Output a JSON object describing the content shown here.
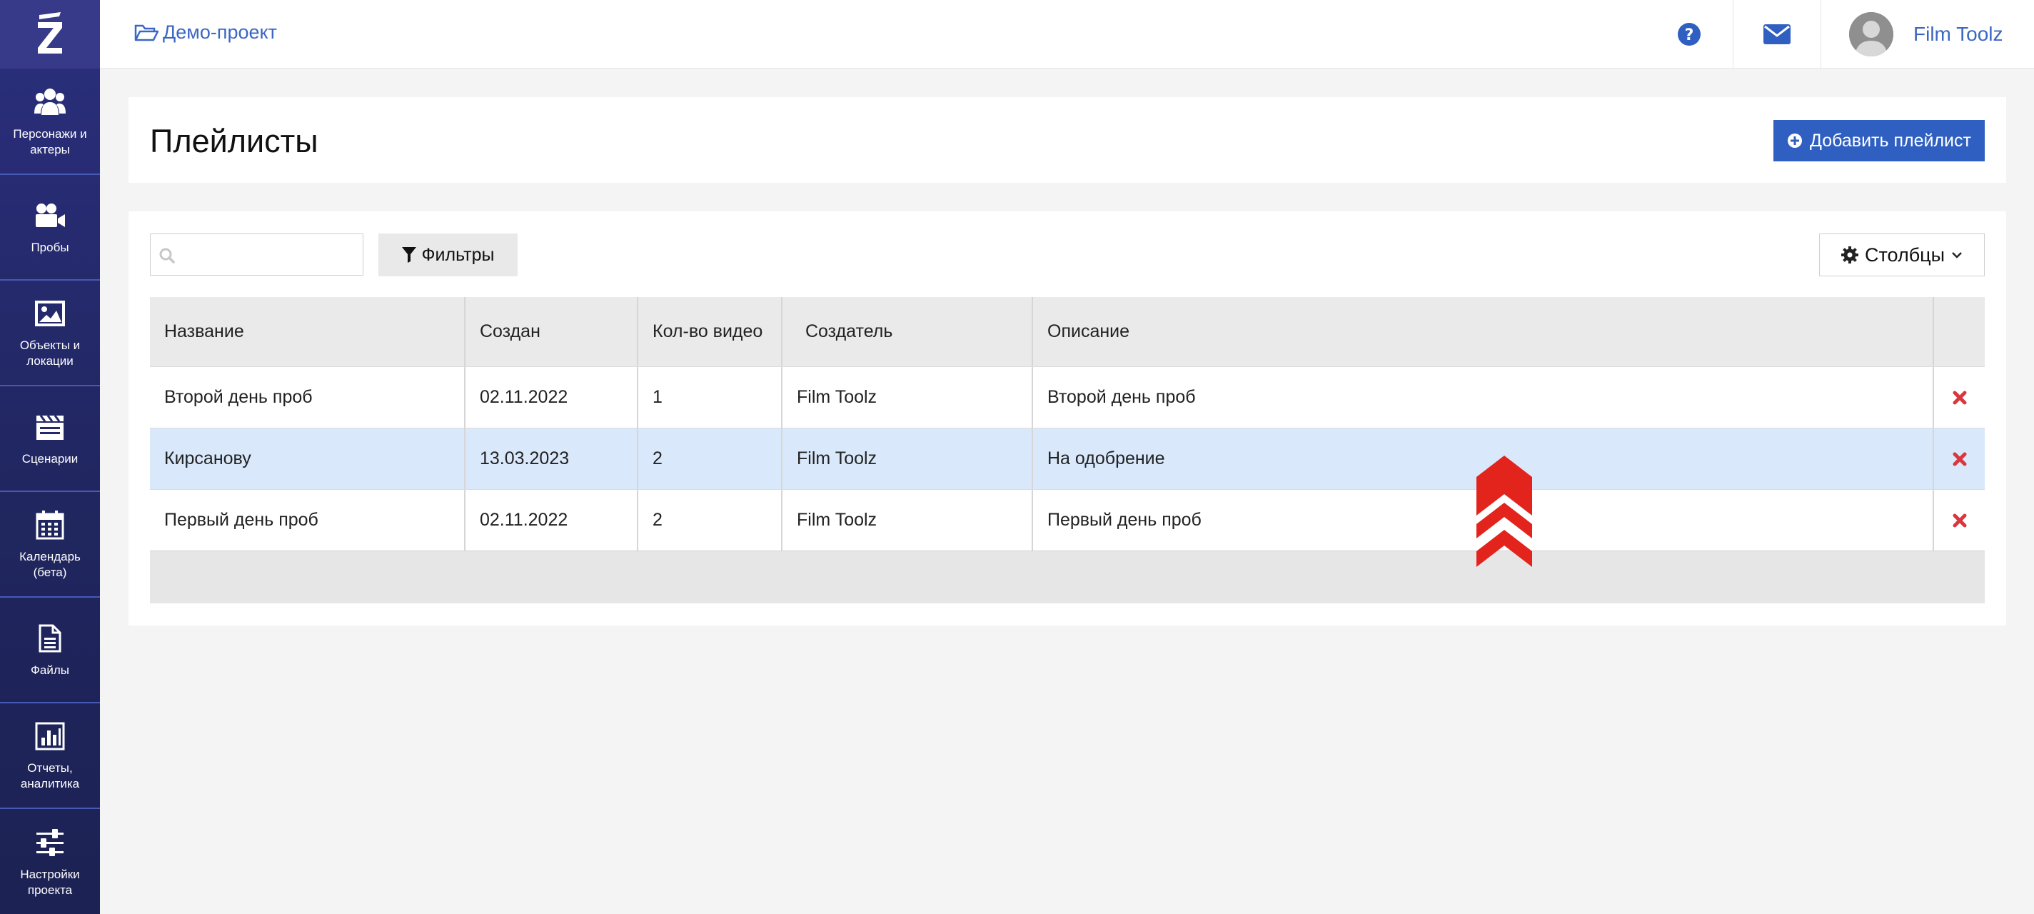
{
  "sidebar": {
    "logo": "logo",
    "items": [
      {
        "label": "Персонажи и актеры",
        "icon": "people-icon"
      },
      {
        "label": "Пробы",
        "icon": "video-camera-icon"
      },
      {
        "label": "Объекты и локации",
        "icon": "image-icon"
      },
      {
        "label": "Сценарии",
        "icon": "clapperboard-icon"
      },
      {
        "label": "Календарь (бета)",
        "icon": "calendar-icon"
      },
      {
        "label": "Файлы",
        "icon": "file-icon"
      },
      {
        "label": "Отчеты, аналитика",
        "icon": "bar-chart-icon"
      },
      {
        "label": "Настройки проекта",
        "icon": "sliders-icon"
      }
    ]
  },
  "topbar": {
    "project": "Демо-проект",
    "user_name": "Film Toolz"
  },
  "page": {
    "title": "Плейлисты",
    "add_button": "Добавить плейлист"
  },
  "toolbar": {
    "search_value": "",
    "filters_label": "Фильтры",
    "columns_label": "Столбцы"
  },
  "table": {
    "columns": [
      "Название",
      "Создан",
      "Кол-во видео",
      "Создатель",
      "Описание"
    ],
    "rows": [
      {
        "name": "Второй день проб",
        "created": "02.11.2022",
        "videos": "1",
        "creator": "Film Toolz",
        "description": "Второй день проб"
      },
      {
        "name": "Кирсанову",
        "created": "13.03.2023",
        "videos": "2",
        "creator": "Film Toolz",
        "description": "На одобрение"
      },
      {
        "name": "Первый день проб",
        "created": "02.11.2022",
        "videos": "2",
        "creator": "Film Toolz",
        "description": "Первый день проб"
      }
    ],
    "selected_row": 1
  },
  "colors": {
    "sidebar": "#23296a",
    "accent": "#2f5fc1",
    "link": "#3b67c4",
    "delete": "#d9363e",
    "selected_row": "#d9e8fb",
    "scroll_up": "#e3241d"
  }
}
